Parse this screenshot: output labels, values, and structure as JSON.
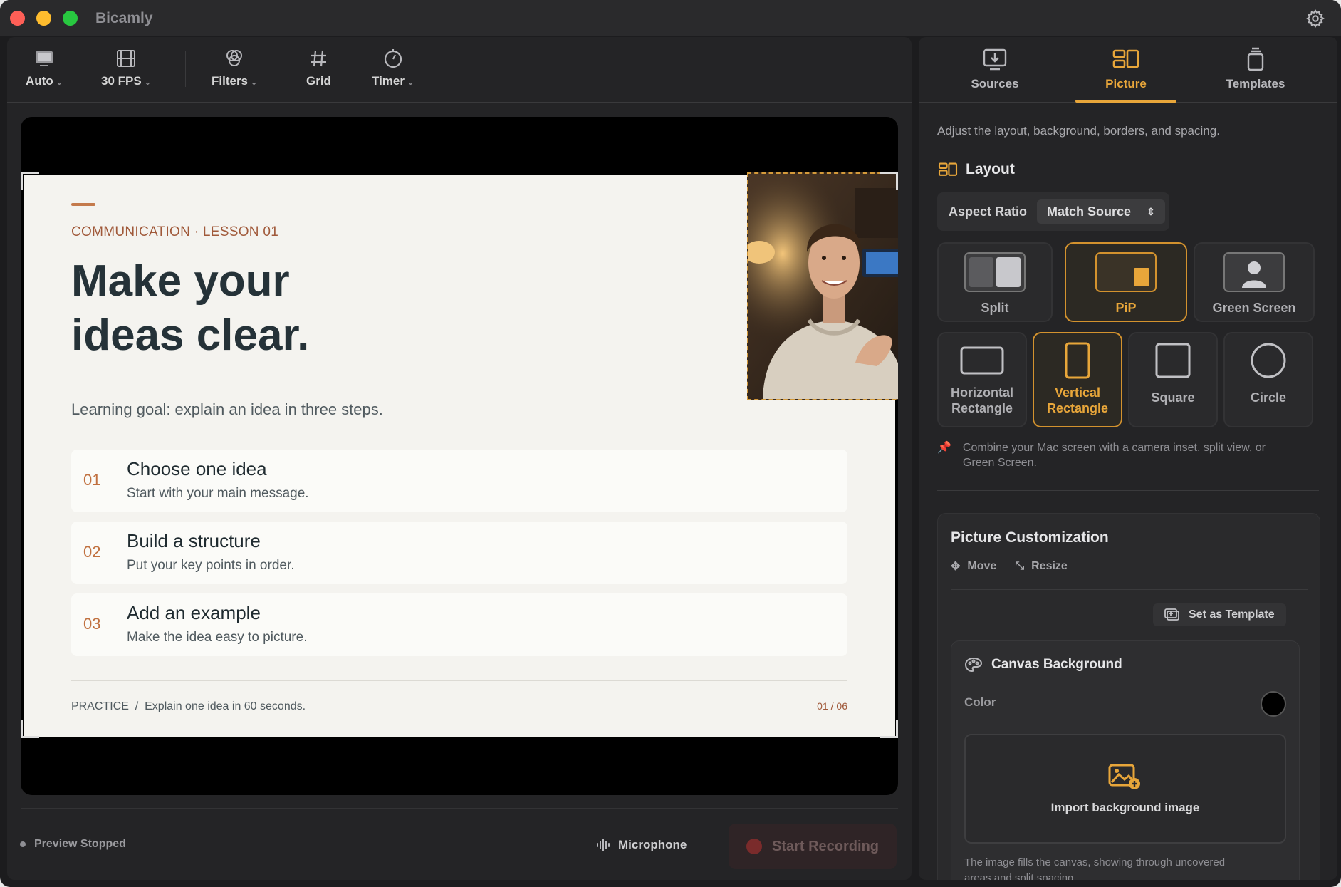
{
  "app": {
    "title": "Bicamly"
  },
  "toolbar": {
    "items": [
      {
        "label": "Auto",
        "icon": "display-icon",
        "dropdown": true
      },
      {
        "label": "30 FPS",
        "icon": "film-icon",
        "dropdown": true
      },
      {
        "label": "Filters",
        "icon": "filters-icon",
        "dropdown": true
      },
      {
        "label": "Grid",
        "icon": "grid-icon",
        "dropdown": false
      },
      {
        "label": "Timer",
        "icon": "timer-icon",
        "dropdown": true
      }
    ]
  },
  "slide": {
    "eyebrow": "COMMUNICATION · LESSON 01",
    "headline_line1": "Make your",
    "headline_line2": "ideas clear.",
    "goal": "Learning goal: explain an idea in three steps.",
    "steps": [
      {
        "num": "01",
        "title": "Choose one idea",
        "desc": "Start with your main message."
      },
      {
        "num": "02",
        "title": "Build a structure",
        "desc": "Put your key points in order."
      },
      {
        "num": "03",
        "title": "Add an example",
        "desc": "Make the idea easy to picture."
      }
    ],
    "footer_left": "PRACTICE  /  Explain one idea in 60 seconds.",
    "footer_right": "01 / 06"
  },
  "bottombar": {
    "status": "Preview Stopped",
    "microphone": "Microphone",
    "record": "Start Recording"
  },
  "right": {
    "tabs": [
      {
        "label": "Sources",
        "icon": "sources-icon"
      },
      {
        "label": "Picture",
        "icon": "picture-icon",
        "active": true
      },
      {
        "label": "Templates",
        "icon": "templates-icon"
      }
    ],
    "description": "Adjust the layout, background, borders, and spacing.",
    "layout": {
      "title": "Layout",
      "aspect_label": "Aspect Ratio",
      "aspect_value": "Match Source",
      "modes": [
        {
          "label": "Split"
        },
        {
          "label": "PiP",
          "active": true
        },
        {
          "label": "Green Screen"
        }
      ],
      "shapes": [
        {
          "line1": "Horizontal",
          "line2": "Rectangle"
        },
        {
          "line1": "Vertical",
          "line2": "Rectangle",
          "active": true
        },
        {
          "line1": "Square",
          "line2": ""
        },
        {
          "line1": "Circle",
          "line2": ""
        }
      ],
      "hint_line1": "Combine your Mac screen with a camera inset, split view, or",
      "hint_line2": "Green Screen."
    },
    "customization": {
      "title": "Picture Customization",
      "move": "Move",
      "resize": "Resize",
      "set_template": "Set as Template",
      "canvas": {
        "title": "Canvas Background",
        "color_label": "Color",
        "color_value": "#000000",
        "import_label": "Import background image",
        "note_line1": "The image fills the canvas, showing through uncovered",
        "note_line2": "areas and split spacing."
      }
    }
  },
  "colors": {
    "accent": "#e8a63a",
    "slide_accent": "#c47a4c",
    "background": "#1c1c1e"
  }
}
